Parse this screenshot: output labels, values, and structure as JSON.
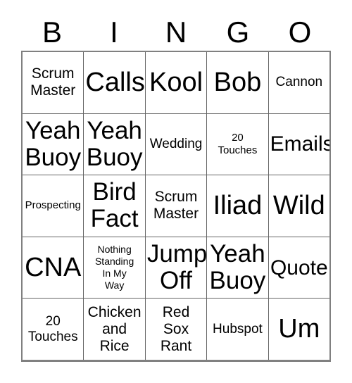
{
  "card": {
    "header_letters": [
      "B",
      "I",
      "N",
      "G",
      "O"
    ],
    "border_color": "#666666",
    "outer_border_color": "#808080",
    "background_color": "#ffffff",
    "text_color": "#000000",
    "rows": [
      [
        {
          "text": "Scrum\nMaster",
          "size": "l"
        },
        {
          "text": "Calls",
          "size": "max"
        },
        {
          "text": "Kool",
          "size": "max"
        },
        {
          "text": "Bob",
          "size": "max"
        },
        {
          "text": "Cannon",
          "size": "m"
        }
      ],
      [
        {
          "text": "Yeah\nBuoy",
          "size": "xxl"
        },
        {
          "text": "Yeah\nBuoy",
          "size": "xxl"
        },
        {
          "text": "Wedding",
          "size": "m"
        },
        {
          "text": "20\nTouches",
          "size": "s"
        },
        {
          "text": "Emails",
          "size": "xl"
        }
      ],
      [
        {
          "text": "Prospecting",
          "size": "s"
        },
        {
          "text": "Bird\nFact",
          "size": "xxl"
        },
        {
          "text": "Scrum\nMaster",
          "size": "l"
        },
        {
          "text": "Iliad",
          "size": "max"
        },
        {
          "text": "Wild",
          "size": "max"
        }
      ],
      [
        {
          "text": "CNA",
          "size": "max"
        },
        {
          "text": "Nothing\nStanding\nIn My\nWay",
          "size": "xs"
        },
        {
          "text": "Jump\nOff",
          "size": "xxl"
        },
        {
          "text": "Yeah\nBuoy",
          "size": "xxl"
        },
        {
          "text": "Quote",
          "size": "xl"
        }
      ],
      [
        {
          "text": "20\nTouches",
          "size": "m"
        },
        {
          "text": "Chicken\nand\nRice",
          "size": "l"
        },
        {
          "text": "Red\nSox\nRant",
          "size": "l"
        },
        {
          "text": "Hubspot",
          "size": "m"
        },
        {
          "text": "Um",
          "size": "max"
        }
      ]
    ]
  }
}
